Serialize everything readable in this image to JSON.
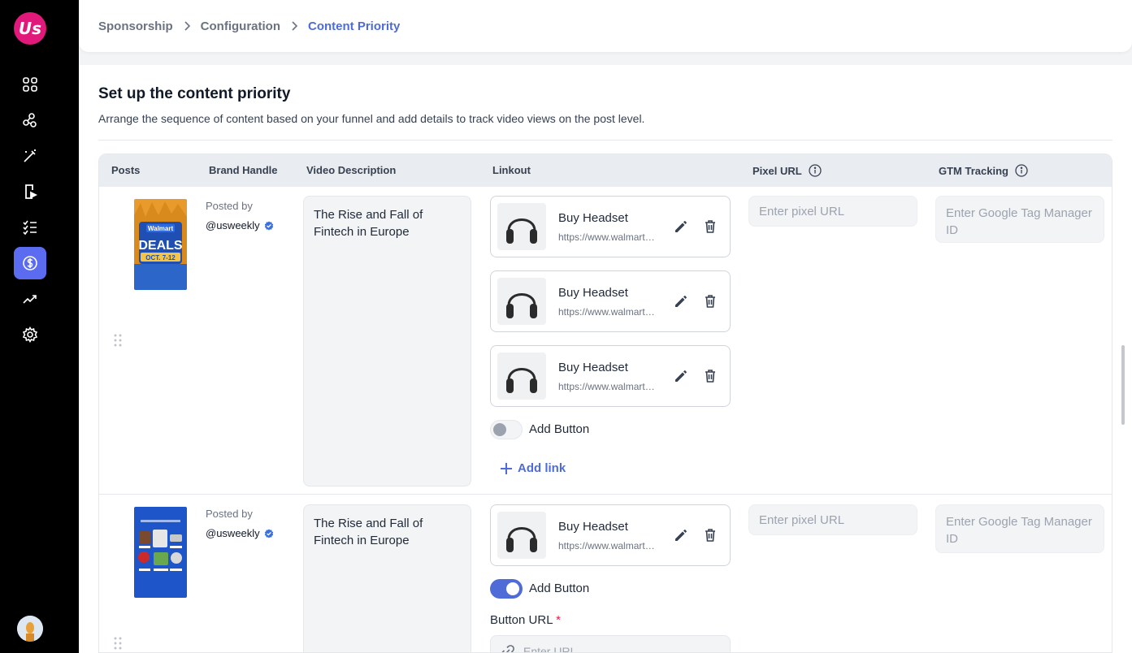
{
  "app": {
    "logo_text": "Us"
  },
  "breadcrumb": [
    "Sponsorship",
    "Configuration",
    "Content Priority"
  ],
  "page": {
    "title": "Set up the content priority",
    "subtitle": "Arrange the sequence of content based on your funnel and add details to track video views on the post level."
  },
  "table": {
    "headers": {
      "posts": "Posts",
      "brand_handle": "Brand Handle",
      "video_description": "Video Description",
      "linkout": "Linkout",
      "pixel_url": "Pixel URL",
      "gtm_tracking": "GTM Tracking"
    }
  },
  "rows": [
    {
      "thumb": {
        "brand": "Walmart",
        "headline": "DEALS",
        "dates": "OCT. 7-12"
      },
      "posted_by": "Posted by",
      "handle": "@usweekly",
      "description": "The Rise and Fall of Fintech in Europe",
      "links": [
        {
          "title": "Buy Headset",
          "url": "https://www.walmart.com/ip/headset"
        },
        {
          "title": "Buy Headset",
          "url": "https://www.walmart.com/ip/headset"
        },
        {
          "title": "Buy Headset",
          "url": "https://www.walmart.com/ip/headset"
        }
      ],
      "add_button_label": "Add Button",
      "add_link_label": "Add link",
      "pixel_placeholder": "Enter pixel URL",
      "gtm_placeholder": "Enter Google Tag Manager ID"
    },
    {
      "posted_by": "Posted by",
      "handle": "@usweekly",
      "description": "The Rise and Fall of Fintech in Europe",
      "links": [
        {
          "title": "Buy Headset",
          "url": "https://www.walmart.com/ip/headset"
        }
      ],
      "add_button_label": "Add Button",
      "button_url_label": "Button URL",
      "button_url_required": "*",
      "button_url_placeholder": "Enter URL",
      "pixel_placeholder": "Enter pixel URL",
      "gtm_placeholder": "Enter Google Tag Manager ID"
    }
  ],
  "colors": {
    "accent": "#4f6bd8",
    "sidebar_active": "#5b6cf0",
    "logo": "#e0197a"
  }
}
